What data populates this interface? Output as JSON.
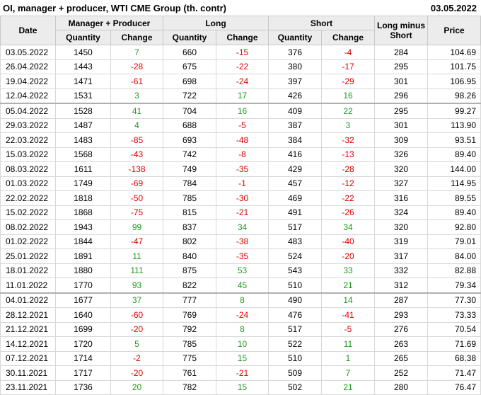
{
  "header": {
    "title": "OI, manager + producer, WTI CME Group (th. contr)",
    "date": "03.05.2022"
  },
  "columns": {
    "date": "Date",
    "group_mp": "Manager + Producer",
    "group_long": "Long",
    "group_short": "Short",
    "long_minus_short": "Long minus Short",
    "price": "Price",
    "quantity": "Quantity",
    "change": "Change"
  },
  "colors": {
    "positive": "#1f9a1f",
    "negative": "#e00000"
  },
  "rows": [
    {
      "date": "03.05.2022",
      "mp_q": "1450",
      "mp_c": "7",
      "l_q": "660",
      "l_c": "-15",
      "s_q": "376",
      "s_c": "-4",
      "lms": "284",
      "price": "104.69"
    },
    {
      "date": "26.04.2022",
      "mp_q": "1443",
      "mp_c": "-28",
      "l_q": "675",
      "l_c": "-22",
      "s_q": "380",
      "s_c": "-17",
      "lms": "295",
      "price": "101.75"
    },
    {
      "date": "19.04.2022",
      "mp_q": "1471",
      "mp_c": "-61",
      "l_q": "698",
      "l_c": "-24",
      "s_q": "397",
      "s_c": "-29",
      "lms": "301",
      "price": "106.95"
    },
    {
      "date": "12.04.2022",
      "mp_q": "1531",
      "mp_c": "3",
      "l_q": "722",
      "l_c": "17",
      "s_q": "426",
      "s_c": "16",
      "lms": "296",
      "price": "98.26"
    },
    {
      "date": "05.04.2022",
      "mp_q": "1528",
      "mp_c": "41",
      "l_q": "704",
      "l_c": "16",
      "s_q": "409",
      "s_c": "22",
      "lms": "295",
      "price": "99.27"
    },
    {
      "date": "29.03.2022",
      "mp_q": "1487",
      "mp_c": "4",
      "l_q": "688",
      "l_c": "-5",
      "s_q": "387",
      "s_c": "3",
      "lms": "301",
      "price": "113.90"
    },
    {
      "date": "22.03.2022",
      "mp_q": "1483",
      "mp_c": "-85",
      "l_q": "693",
      "l_c": "-48",
      "s_q": "384",
      "s_c": "-32",
      "lms": "309",
      "price": "93.51"
    },
    {
      "date": "15.03.2022",
      "mp_q": "1568",
      "mp_c": "-43",
      "l_q": "742",
      "l_c": "-8",
      "s_q": "416",
      "s_c": "-13",
      "lms": "326",
      "price": "89.40"
    },
    {
      "date": "08.03.2022",
      "mp_q": "1611",
      "mp_c": "-138",
      "l_q": "749",
      "l_c": "-35",
      "s_q": "429",
      "s_c": "-28",
      "lms": "320",
      "price": "144.00"
    },
    {
      "date": "01.03.2022",
      "mp_q": "1749",
      "mp_c": "-69",
      "l_q": "784",
      "l_c": "-1",
      "s_q": "457",
      "s_c": "-12",
      "lms": "327",
      "price": "114.95"
    },
    {
      "date": "22.02.2022",
      "mp_q": "1818",
      "mp_c": "-50",
      "l_q": "785",
      "l_c": "-30",
      "s_q": "469",
      "s_c": "-22",
      "lms": "316",
      "price": "89.55"
    },
    {
      "date": "15.02.2022",
      "mp_q": "1868",
      "mp_c": "-75",
      "l_q": "815",
      "l_c": "-21",
      "s_q": "491",
      "s_c": "-26",
      "lms": "324",
      "price": "89.40"
    },
    {
      "date": "08.02.2022",
      "mp_q": "1943",
      "mp_c": "99",
      "l_q": "837",
      "l_c": "34",
      "s_q": "517",
      "s_c": "34",
      "lms": "320",
      "price": "92.80"
    },
    {
      "date": "01.02.2022",
      "mp_q": "1844",
      "mp_c": "-47",
      "l_q": "802",
      "l_c": "-38",
      "s_q": "483",
      "s_c": "-40",
      "lms": "319",
      "price": "79.01"
    },
    {
      "date": "25.01.2022",
      "mp_q": "1891",
      "mp_c": "11",
      "l_q": "840",
      "l_c": "-35",
      "s_q": "524",
      "s_c": "-20",
      "lms": "317",
      "price": "84.00"
    },
    {
      "date": "18.01.2022",
      "mp_q": "1880",
      "mp_c": "111",
      "l_q": "875",
      "l_c": "53",
      "s_q": "543",
      "s_c": "33",
      "lms": "332",
      "price": "82.88"
    },
    {
      "date": "11.01.2022",
      "mp_q": "1770",
      "mp_c": "93",
      "l_q": "822",
      "l_c": "45",
      "s_q": "510",
      "s_c": "21",
      "lms": "312",
      "price": "79.34"
    },
    {
      "date": "04.01.2022",
      "mp_q": "1677",
      "mp_c": "37",
      "l_q": "777",
      "l_c": "8",
      "s_q": "490",
      "s_c": "14",
      "lms": "287",
      "price": "77.30"
    },
    {
      "date": "28.12.2021",
      "mp_q": "1640",
      "mp_c": "-60",
      "l_q": "769",
      "l_c": "-24",
      "s_q": "476",
      "s_c": "-41",
      "lms": "293",
      "price": "73.33"
    },
    {
      "date": "21.12.2021",
      "mp_q": "1699",
      "mp_c": "-20",
      "l_q": "792",
      "l_c": "8",
      "s_q": "517",
      "s_c": "-5",
      "lms": "276",
      "price": "70.54"
    },
    {
      "date": "14.12.2021",
      "mp_q": "1720",
      "mp_c": "5",
      "l_q": "785",
      "l_c": "10",
      "s_q": "522",
      "s_c": "11",
      "lms": "263",
      "price": "71.69"
    },
    {
      "date": "07.12.2021",
      "mp_q": "1714",
      "mp_c": "-2",
      "l_q": "775",
      "l_c": "15",
      "s_q": "510",
      "s_c": "1",
      "lms": "265",
      "price": "68.38"
    },
    {
      "date": "30.11.2021",
      "mp_q": "1717",
      "mp_c": "-20",
      "l_q": "761",
      "l_c": "-21",
      "s_q": "509",
      "s_c": "7",
      "lms": "252",
      "price": "71.47"
    },
    {
      "date": "23.11.2021",
      "mp_q": "1736",
      "mp_c": "20",
      "l_q": "782",
      "l_c": "15",
      "s_q": "502",
      "s_c": "21",
      "lms": "280",
      "price": "76.47"
    }
  ]
}
